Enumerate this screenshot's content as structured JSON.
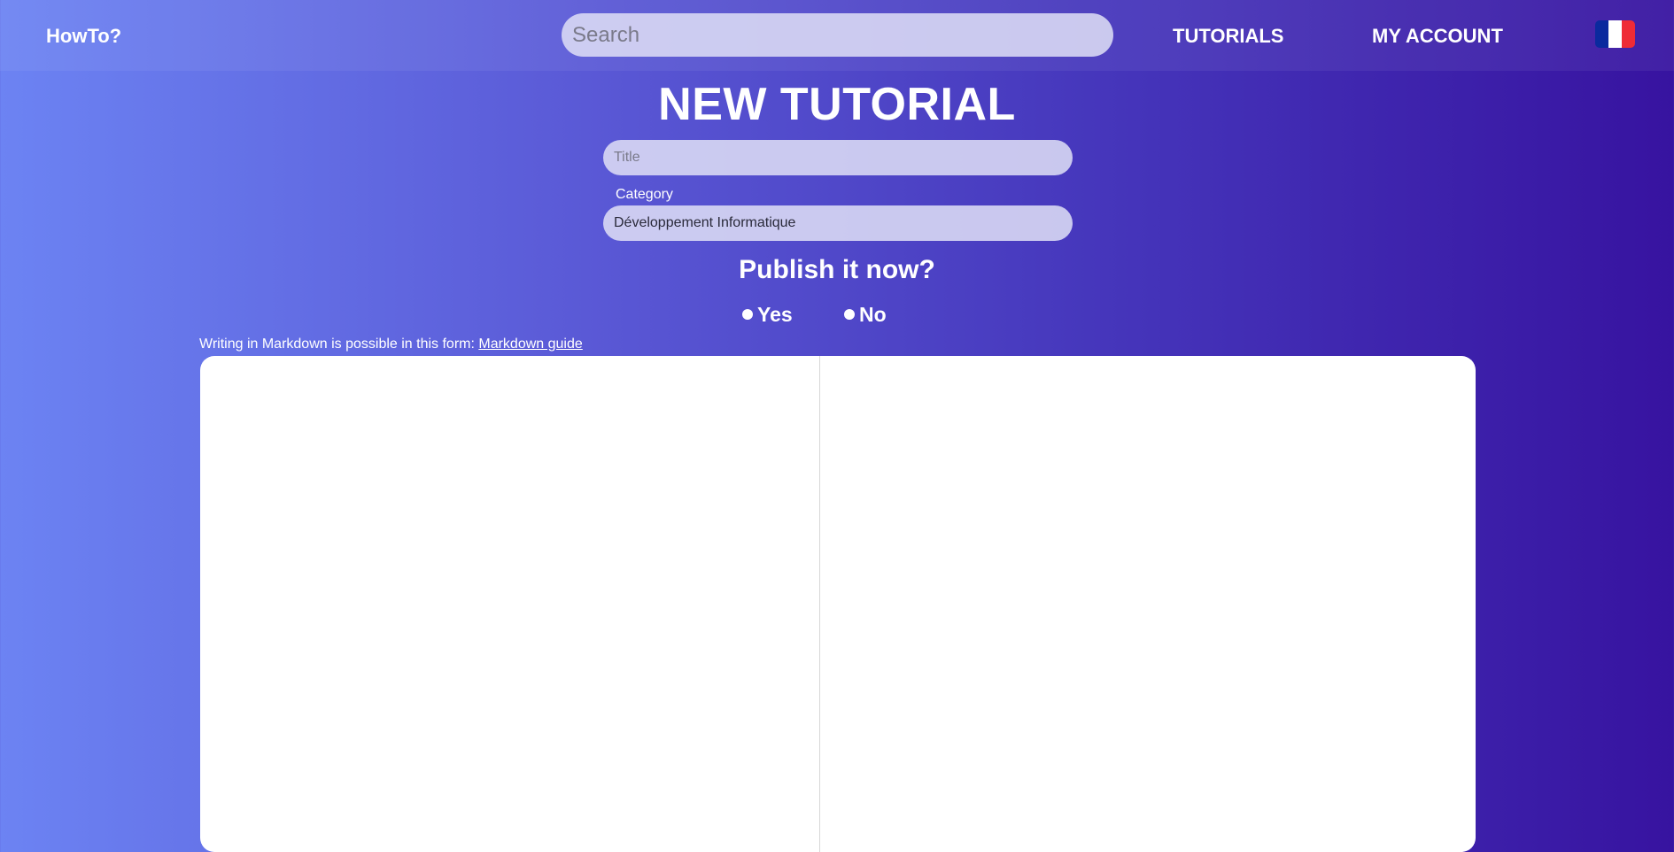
{
  "header": {
    "brand": "HowTo?",
    "search_placeholder": "Search",
    "nav": {
      "tutorials": "TUTORIALS",
      "my_account": "MY ACCOUNT"
    },
    "language_flag": {
      "icon": "france-flag-icon",
      "colors": [
        "#0a2a9e",
        "#ffffff",
        "#ef2b36"
      ]
    }
  },
  "form": {
    "page_title": "NEW TUTORIAL",
    "title_placeholder": "Title",
    "category_label": "Category",
    "category_value": "Développement Informatique",
    "publish_question": "Publish it now?",
    "publish_options": {
      "yes": "Yes",
      "no": "No"
    },
    "markdown_hint": "Writing in Markdown is possible in this form: ",
    "markdown_link": "Markdown guide",
    "editor_content": "",
    "preview_content": ""
  },
  "theme": {
    "gradient_start": "#6c83f3",
    "gradient_end": "#3713a0"
  }
}
